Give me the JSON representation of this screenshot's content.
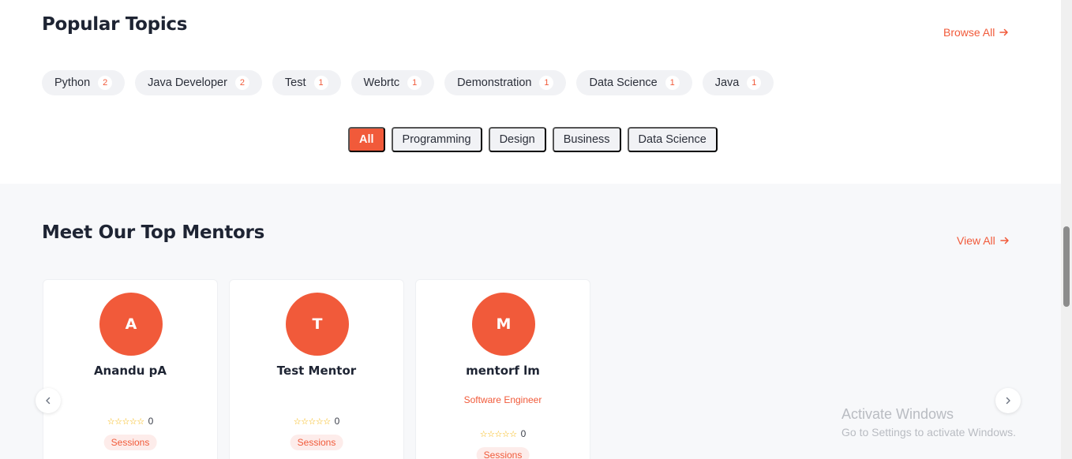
{
  "topics": {
    "title": "Popular Topics",
    "browse_all": "Browse All",
    "chips": [
      {
        "label": "Python",
        "count": "2"
      },
      {
        "label": "Java Developer",
        "count": "2"
      },
      {
        "label": "Test",
        "count": "1"
      },
      {
        "label": "Webrtc",
        "count": "1"
      },
      {
        "label": "Demonstration",
        "count": "1"
      },
      {
        "label": "Data Science",
        "count": "1"
      },
      {
        "label": "Java",
        "count": "1"
      }
    ],
    "filters": [
      "All",
      "Programming",
      "Design",
      "Business",
      "Data Science"
    ],
    "active_filter": "All"
  },
  "mentors": {
    "title": "Meet Our Top Mentors",
    "view_all": "View All",
    "cards": [
      {
        "initial": "A",
        "name": "Anandu pA",
        "role": "",
        "rating": "0",
        "badge": "Sessions"
      },
      {
        "initial": "T",
        "name": "Test Mentor",
        "role": "",
        "rating": "0",
        "badge": "Sessions"
      },
      {
        "initial": "M",
        "name": "mentorf lm",
        "role": "Software Engineer",
        "rating": "0",
        "badge": "Sessions"
      }
    ]
  },
  "watermark": {
    "line1": "Activate Windows",
    "line2": "Go to Settings to activate Windows."
  },
  "icons": {
    "arrow": "arrow-right-icon",
    "prev": "chevron-left-icon",
    "next": "chevron-right-icon",
    "star": "star-outline-icon"
  },
  "colors": {
    "accent": "#f15a3a",
    "section_bg": "#f7f8fa",
    "chip_bg": "#f1f2f5",
    "star": "#f5b301"
  }
}
